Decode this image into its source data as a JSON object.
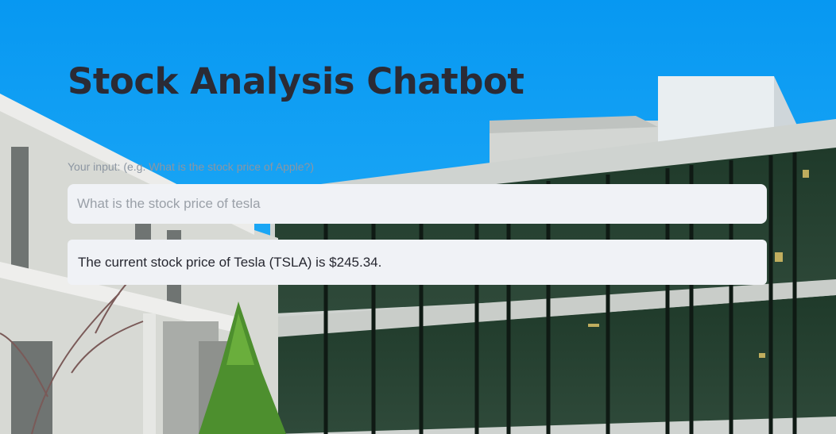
{
  "app": {
    "title": "Stock Analysis Chatbot"
  },
  "input": {
    "label": "Your input: (e.g. What is the stock price of Apple?)",
    "value": "What is the stock price of tesla"
  },
  "response": {
    "text": "The current stock price of Tesla (TSLA) is $245.34."
  },
  "colors": {
    "title": "#2b2b35",
    "sky": "#0aa0f5",
    "field_background": "#f0f2f6",
    "response_text": "#262730"
  }
}
